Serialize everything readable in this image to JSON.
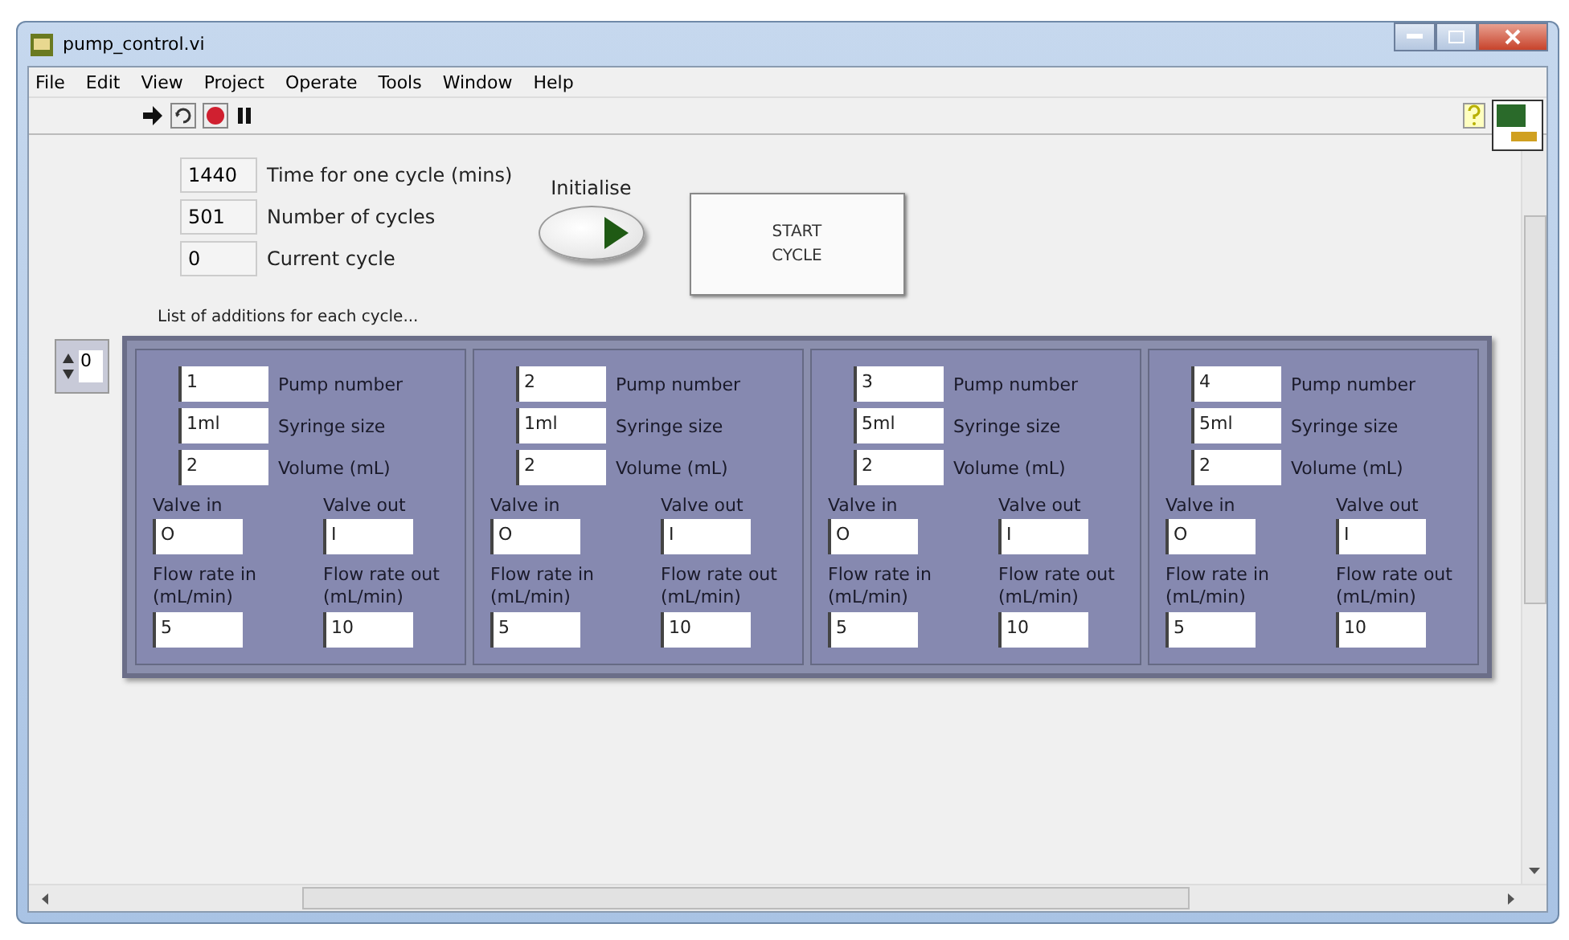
{
  "window": {
    "title": "pump_control.vi"
  },
  "menu": [
    "File",
    "Edit",
    "View",
    "Project",
    "Operate",
    "Tools",
    "Window",
    "Help"
  ],
  "indicators": [
    {
      "value": "1440",
      "label": "Time for one cycle  (mins)"
    },
    {
      "value": "501",
      "label": "Number of cycles"
    },
    {
      "value": "0",
      "label": "Current cycle"
    }
  ],
  "initialise": {
    "label": "Initialise",
    "on": true
  },
  "start_button": "START\nCYCLE",
  "array": {
    "label": "List of additions for each cycle...",
    "index": "0",
    "items": [
      {
        "pump_number": "1",
        "pump_label": "Pump number",
        "syringe": "1ml",
        "syringe_label": "Syringe size",
        "volume": "2",
        "volume_label": "Volume (mL)",
        "valve_in_label": "Valve in",
        "valve_in": "O",
        "valve_out_label": "Valve out",
        "valve_out": "I",
        "flow_in_label": "Flow rate in\n(mL/min)",
        "flow_in": "5",
        "flow_out_label": "Flow rate out\n(mL/min)",
        "flow_out": "10"
      },
      {
        "pump_number": "2",
        "pump_label": "Pump number",
        "syringe": "1ml",
        "syringe_label": "Syringe size",
        "volume": "2",
        "volume_label": "Volume (mL)",
        "valve_in_label": "Valve in",
        "valve_in": "O",
        "valve_out_label": "Valve out",
        "valve_out": "I",
        "flow_in_label": "Flow rate in\n(mL/min)",
        "flow_in": "5",
        "flow_out_label": "Flow rate out\n(mL/min)",
        "flow_out": "10"
      },
      {
        "pump_number": "3",
        "pump_label": "Pump number",
        "syringe": "5ml",
        "syringe_label": "Syringe size",
        "volume": "2",
        "volume_label": "Volume (mL)",
        "valve_in_label": "Valve in",
        "valve_in": "O",
        "valve_out_label": "Valve out",
        "valve_out": "I",
        "flow_in_label": "Flow rate in\n(mL/min)",
        "flow_in": "5",
        "flow_out_label": "Flow rate out\n(mL/min)",
        "flow_out": "10"
      },
      {
        "pump_number": "4",
        "pump_label": "Pump number",
        "syringe": "5ml",
        "syringe_label": "Syringe size",
        "volume": "2",
        "volume_label": "Volume (mL)",
        "valve_in_label": "Valve in",
        "valve_in": "O",
        "valve_out_label": "Valve out",
        "valve_out": "I",
        "flow_in_label": "Flow rate in\n(mL/min)",
        "flow_in": "5",
        "flow_out_label": "Flow rate out\n(mL/min)",
        "flow_out": "10"
      }
    ]
  }
}
